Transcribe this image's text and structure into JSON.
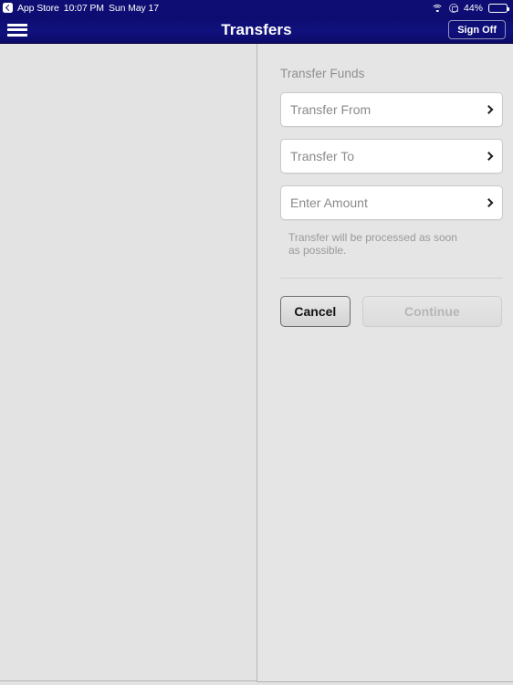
{
  "status_bar": {
    "back_app_label": "App Store",
    "back_icon": "chevron-left-icon",
    "time": "10:07 PM",
    "date": "Sun May 17",
    "wifi_icon": "wifi-icon",
    "rotation_lock_icon": "rotation-lock-icon",
    "battery_percent": "44%",
    "battery_icon": "battery-icon",
    "battery_level": 44
  },
  "nav_bar": {
    "menu_icon": "hamburger-menu-icon",
    "title": "Transfers",
    "sign_off_label": "Sign Off",
    "background_color": "#0d0d73"
  },
  "main": {
    "heading": "Transfer Funds",
    "fields": [
      {
        "name": "transfer-from",
        "label": "Transfer From",
        "value": "",
        "chevron": "chevron-right-icon"
      },
      {
        "name": "transfer-to",
        "label": "Transfer To",
        "value": "",
        "chevron": "chevron-right-icon"
      },
      {
        "name": "enter-amount",
        "label": "Enter Amount",
        "value": "",
        "chevron": "chevron-right-icon"
      }
    ],
    "helper_text": "Transfer will be processed as soon as possible.",
    "buttons": {
      "cancel_label": "Cancel",
      "continue_label": "Continue",
      "continue_disabled": true
    }
  },
  "colors": {
    "brand_navy": "#0d0d73",
    "page_background": "#e3e3e3",
    "panel_background": "#e5e5e5",
    "field_background": "#ffffff",
    "muted_text": "#8e8e8e"
  }
}
